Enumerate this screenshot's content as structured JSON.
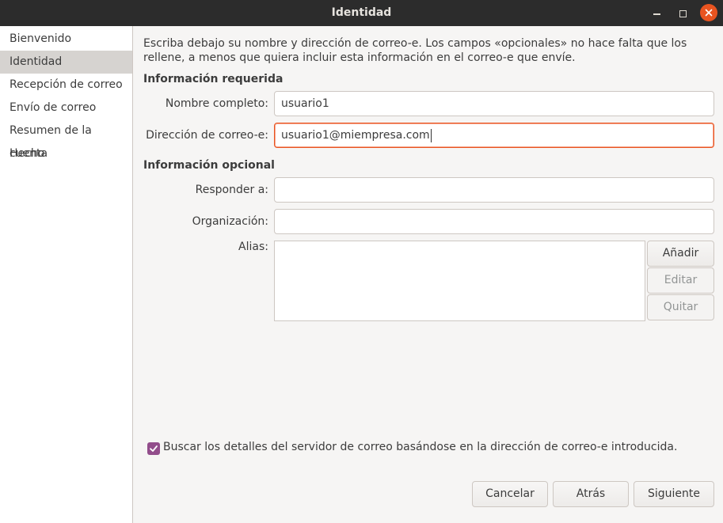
{
  "window": {
    "title": "Identidad"
  },
  "sidebar": {
    "items": [
      {
        "label": "Bienvenido"
      },
      {
        "label": "Identidad",
        "selected": true
      },
      {
        "label": "Recepción de correo"
      },
      {
        "label": "Envío de correo"
      },
      {
        "label": "Resumen de la cuenta"
      },
      {
        "label": "Hecho"
      }
    ]
  },
  "main": {
    "intro": "Escriba debajo su nombre y dirección de correo-e. Los campos «opcionales» no hace falta que los rellene, a menos que quiera incluir esta información en el correo-e que envíe.",
    "required_section": "Información requerida",
    "full_name_label": "Nombre completo:",
    "full_name_value": "usuario1",
    "email_label": "Dirección de correo-e:",
    "email_value": "usuario1@miempresa.com",
    "optional_section": "Información opcional",
    "reply_to_label": "Responder a:",
    "reply_to_value": "",
    "organization_label": "Organización:",
    "organization_value": "",
    "aliases_label": "Alias:",
    "add_button": "Añadir",
    "edit_button": "Editar",
    "remove_button": "Quitar",
    "lookup_checkbox_label": "Buscar los detalles del servidor de correo basándose en la dirección de correo-e introducida.",
    "lookup_checked": true
  },
  "footer": {
    "cancel": "Cancelar",
    "back": "Atrás",
    "next": "Siguiente"
  },
  "colors": {
    "titlebar": "#2c2c2c",
    "close_button": "#e95420",
    "focus_border": "#e95420",
    "checkbox": "#924d8b"
  }
}
